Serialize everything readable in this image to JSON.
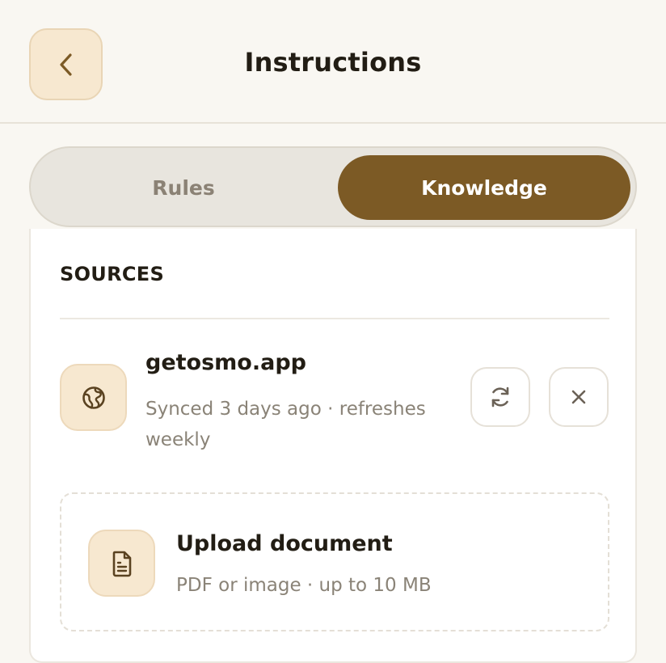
{
  "header": {
    "title": "Instructions",
    "back_icon": "chevron-left-icon"
  },
  "tabs": [
    {
      "label": "Rules",
      "active": false
    },
    {
      "label": "Knowledge",
      "active": true
    }
  ],
  "sources": {
    "section_title": "SOURCES",
    "items": [
      {
        "icon": "globe-icon",
        "name": "getosmo.app",
        "meta": "Synced 3 days ago · refreshes weekly",
        "actions": [
          "refresh-icon",
          "close-icon"
        ]
      }
    ],
    "upload": {
      "icon": "document-icon",
      "title": "Upload document",
      "subtitle": "PDF or image · up to 10 MB"
    }
  },
  "colors": {
    "accent": "#7c5a25",
    "icon_bg": "#f7e8d0",
    "background": "#f9f7f2",
    "muted_text": "#8a8377"
  }
}
